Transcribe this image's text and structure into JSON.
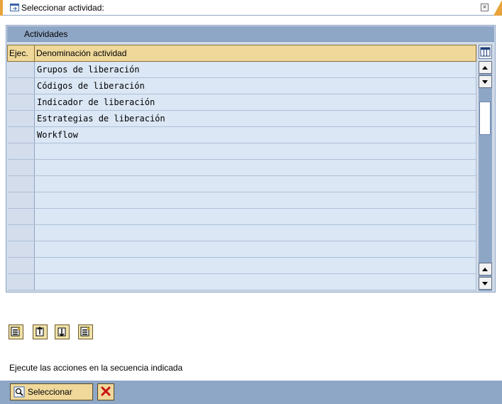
{
  "window": {
    "title": "Seleccionar actividad:",
    "close_glyph": "×"
  },
  "grid": {
    "title": "Actividades",
    "columns": [
      "Ejec.",
      "Denominación actividad"
    ],
    "rows": [
      "Grupos de liberación",
      "Códigos de liberación",
      "Indicador de liberación",
      "Estrategias de liberación",
      "Workflow",
      "",
      "",
      "",
      "",
      "",
      "",
      "",
      "",
      "",
      ""
    ]
  },
  "toolbar_icons": [
    "select-all-icon",
    "expand-icon",
    "collapse-icon",
    "deselect-all-icon"
  ],
  "message": "Ejecute las acciones en la secuencia indicada",
  "footer": {
    "select_label": "Seleccionar",
    "select_icon": "magnifier-check-icon",
    "cancel_icon": "red-x-icon"
  },
  "colors": {
    "accent": "#e8a33a",
    "header_bar": "#8fa7c6",
    "column_header": "#efd89a",
    "row_bg": "#dbe7f5"
  }
}
